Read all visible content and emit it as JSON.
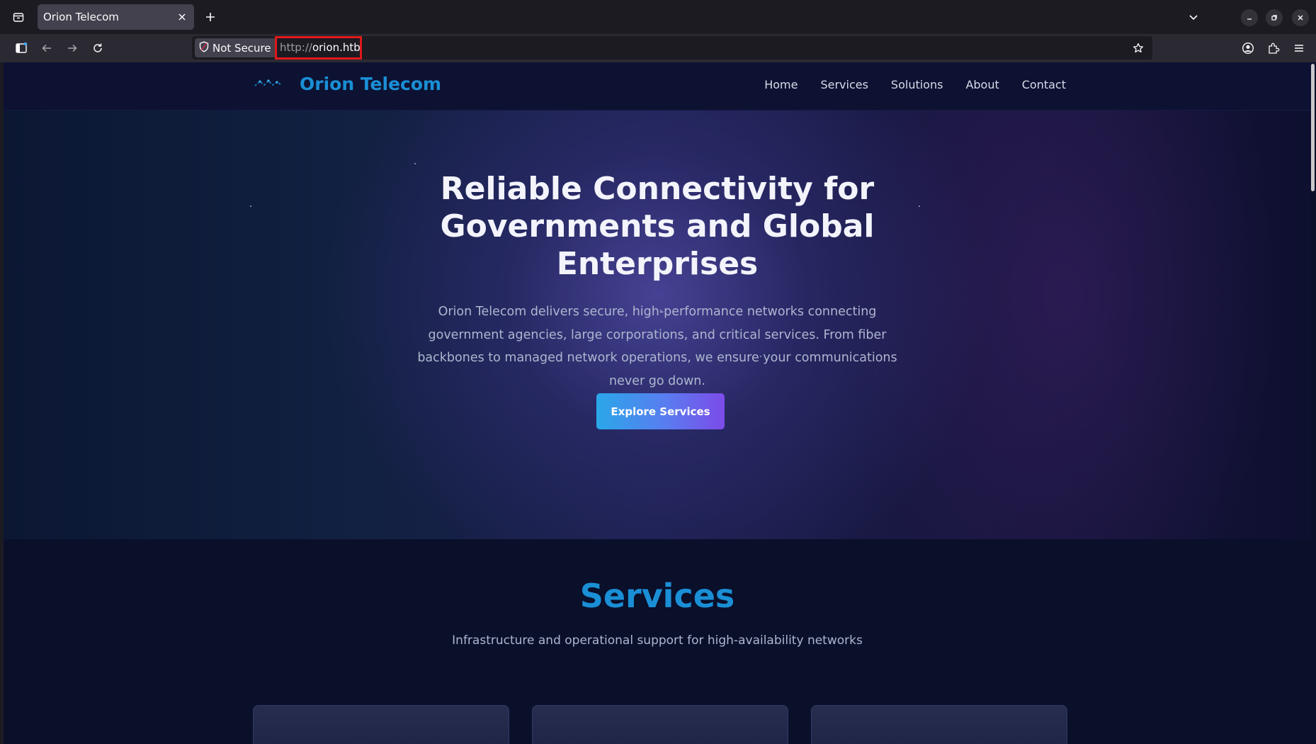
{
  "browser": {
    "tab": {
      "title": "Orion Telecom"
    },
    "identity": {
      "label": "Not Secure"
    },
    "url": {
      "scheme": "http://",
      "host": "orion.htb"
    },
    "icons": {
      "tablist": "tab-list-icon",
      "close_tab": "close-icon",
      "new_tab": "plus-icon",
      "list_all_tabs": "chevron-down-icon",
      "sidebar": "sidebar-icon",
      "back": "back-arrow-icon",
      "forward": "forward-arrow-icon",
      "reload": "reload-icon",
      "shield": "shield-icon",
      "bookmark": "star-icon",
      "account": "account-icon",
      "extensions": "puzzle-icon",
      "menu": "hamburger-menu-icon"
    },
    "highlight_color": "#e0181b"
  },
  "site": {
    "brand": "Orion Telecom",
    "nav": [
      "Home",
      "Services",
      "Solutions",
      "About",
      "Contact"
    ],
    "hero": {
      "title": "Reliable Connectivity for Governments and Global Enterprises",
      "subtitle": "Orion Telecom delivers secure, high-performance networks connecting government agencies, large corporations, and critical services. From fiber backbones to managed network operations, we ensure your communications never go down.",
      "cta": "Explore Services"
    },
    "services": {
      "title": "Services",
      "subtitle": "Infrastructure and operational support for high-availability networks"
    },
    "colors": {
      "accent": "#1a8fd6",
      "page_bg": "#0a0f2a",
      "cta_gradient": [
        "#2aa7e9",
        "#7c4be8"
      ]
    }
  }
}
